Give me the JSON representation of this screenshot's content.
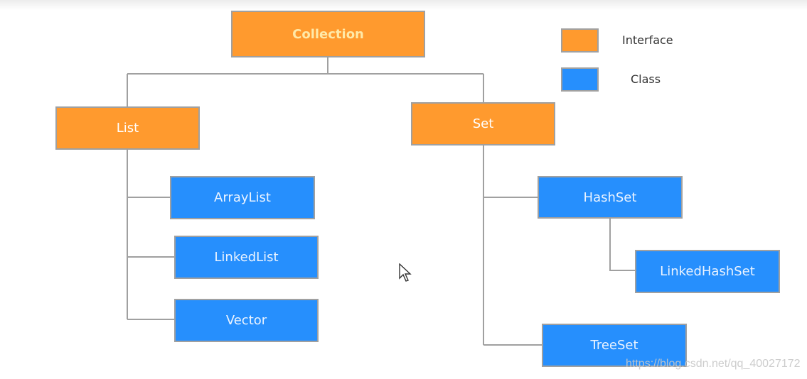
{
  "colors": {
    "interface": "#ff9a2e",
    "class": "#268ffd",
    "connector": "#a0a0a0"
  },
  "nodes": {
    "collection": "Collection",
    "list": "List",
    "set": "Set",
    "arraylist": "ArrayList",
    "linkedlist": "LinkedList",
    "vector": "Vector",
    "hashset": "HashSet",
    "linkedhashset": "LinkedHashSet",
    "treeset": "TreeSet"
  },
  "legend": {
    "interface": "Interface",
    "class": "Class"
  },
  "watermark": "https://blog.csdn.net/qq_40027172",
  "cursor_icon": "arrow-cursor-icon"
}
